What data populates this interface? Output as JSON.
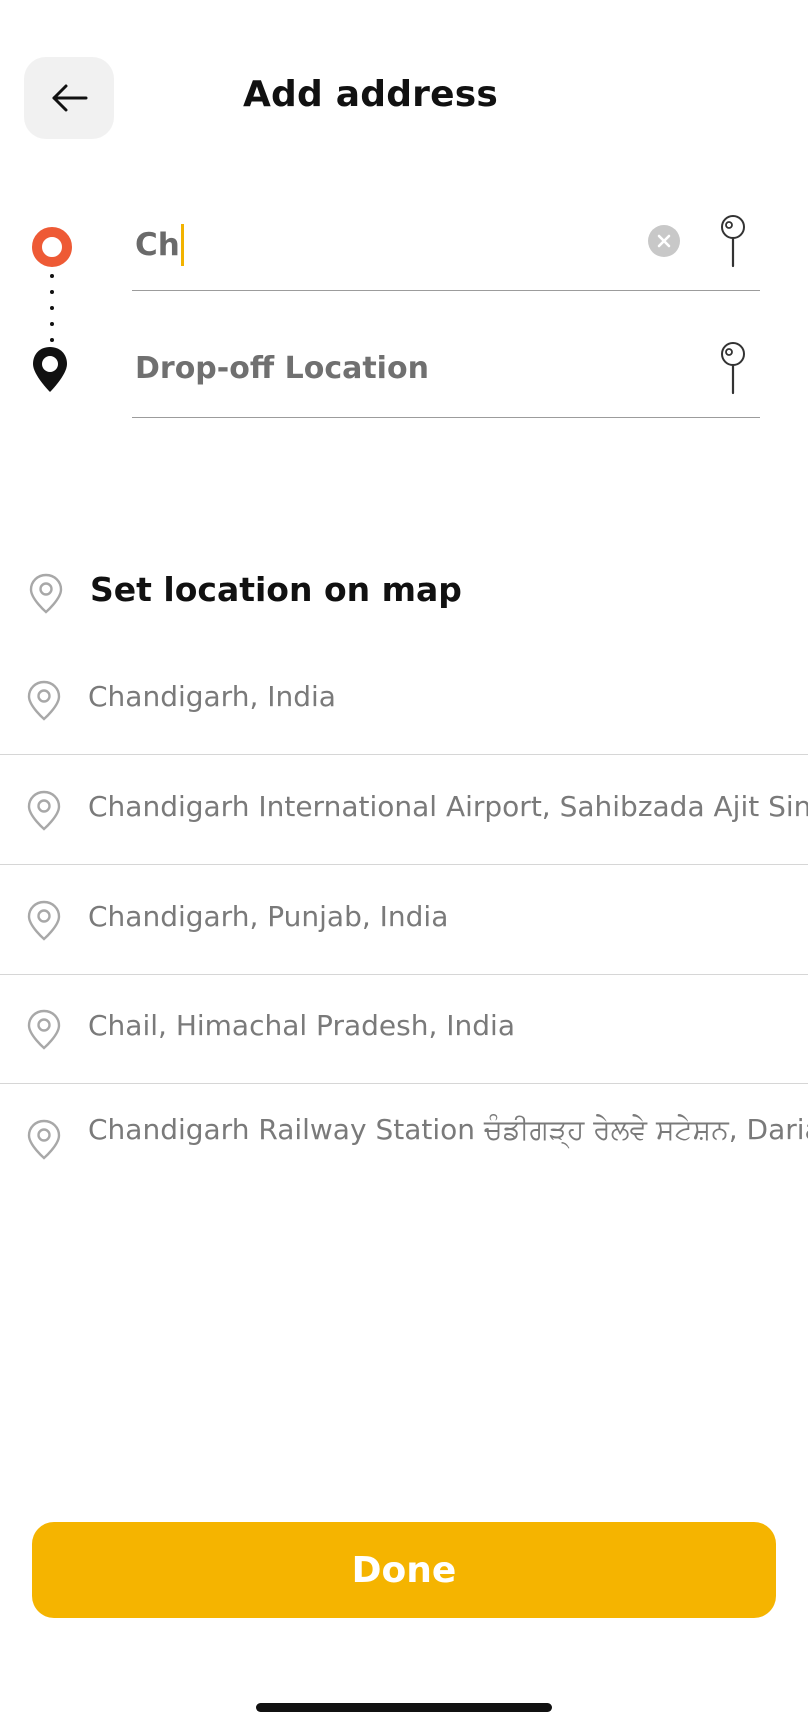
{
  "header": {
    "title": "Add address",
    "back_icon": "arrow-left-icon"
  },
  "route": {
    "pickup_value": "Ch",
    "dropoff_placeholder": "Drop-off Location",
    "pickup_color": "#ee5a35",
    "dropoff_color": "#111111"
  },
  "set_location": {
    "label": "Set location on map"
  },
  "suggestions": [
    {
      "text": "Chandigarh, India"
    },
    {
      "text": "Chandigarh International Airport, Sahibzada Ajit Singh"
    },
    {
      "text": "Chandigarh, Punjab, India"
    },
    {
      "text": "Chail, Himachal Pradesh, India"
    },
    {
      "text": "Chandigarh Railway Station ਚੰਡੀਗੜ੍ਹ ਰੇਲਵੇ ਸਟੇਸ਼ਨ, Daria, C"
    }
  ],
  "footer": {
    "done_label": "Done",
    "accent_color": "#f5b400"
  }
}
